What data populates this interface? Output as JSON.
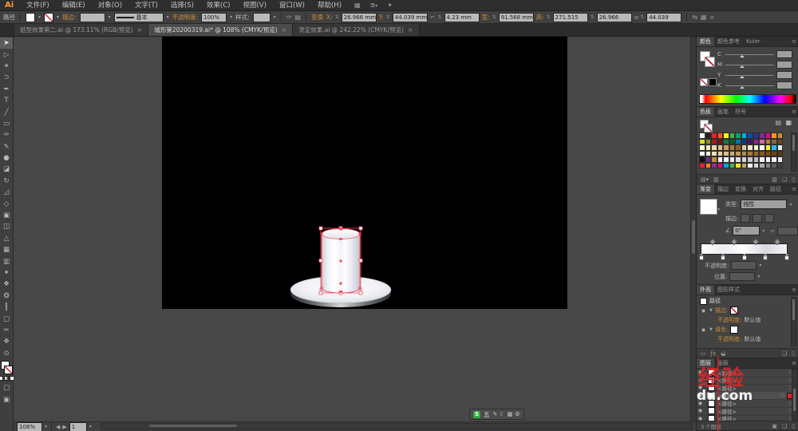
{
  "colors": {
    "accent_orange": "#c98a3c",
    "selection_red": "#f4485a",
    "artboard_bg": "#000000",
    "panel_bg": "#434343"
  },
  "menubar": {
    "logo": "Ai",
    "menus": [
      "文件(F)",
      "编辑(E)",
      "对象(O)",
      "文字(T)",
      "选择(S)",
      "效果(C)",
      "视图(V)",
      "窗口(W)",
      "帮助(H)"
    ]
  },
  "controlbar": {
    "selection_label": "路径",
    "stroke_label": "描边:",
    "profile_value": "基本",
    "opacity_label": "不透明度:",
    "opacity_value": "100%",
    "style_label": "样式:",
    "transform_label": "变换",
    "fields": [
      {
        "label": "X:",
        "value": "26.966 mm"
      },
      {
        "label": "Y:",
        "value": "44.039 mm"
      },
      {
        "label": "",
        "value": "4.23 mm"
      },
      {
        "label": "宽:",
        "value": "91.568 mm"
      },
      {
        "label": "高:",
        "value": "271.515"
      },
      {
        "label": "",
        "value": "26.966"
      },
      {
        "label": "",
        "value": "44.039"
      }
    ]
  },
  "tabbar": {
    "tabs": [
      {
        "title": "纸型效果第二.ai @ 173.11% (RGB/预览)",
        "active": false
      },
      {
        "title": "城形第20200319.ai* @ 108% (CMYK/预览)",
        "active": true
      },
      {
        "title": "烫定效果.ai @ 242.22% (CMYK/预览)",
        "active": false
      }
    ]
  },
  "toolbar": {
    "tools": [
      {
        "name": "selection-tool",
        "glyph": "➤",
        "active": true
      },
      {
        "name": "direct-selection-tool",
        "glyph": "▷",
        "active": false
      },
      {
        "name": "magic-wand-tool",
        "glyph": "✶",
        "active": false
      },
      {
        "name": "lasso-tool",
        "glyph": "⊃",
        "active": false
      },
      {
        "name": "pen-tool",
        "glyph": "✒",
        "active": false
      },
      {
        "name": "type-tool",
        "glyph": "T",
        "active": false
      },
      {
        "name": "line-segment-tool",
        "glyph": "╱",
        "active": false
      },
      {
        "name": "rectangle-tool",
        "glyph": "▭",
        "active": false
      },
      {
        "name": "paintbrush-tool",
        "glyph": "✑",
        "active": false
      },
      {
        "name": "pencil-tool",
        "glyph": "✎",
        "active": false
      },
      {
        "name": "blob-brush-tool",
        "glyph": "●",
        "active": false
      },
      {
        "name": "eraser-tool",
        "glyph": "◪",
        "active": false
      },
      {
        "name": "rotate-tool",
        "glyph": "↻",
        "active": false
      },
      {
        "name": "scale-tool",
        "glyph": "◿",
        "active": false
      },
      {
        "name": "width-tool",
        "glyph": "◇",
        "active": false
      },
      {
        "name": "free-transform-tool",
        "glyph": "▣",
        "active": false
      },
      {
        "name": "shape-builder-tool",
        "glyph": "◫",
        "active": false
      },
      {
        "name": "perspective-grid-tool",
        "glyph": "△",
        "active": false
      },
      {
        "name": "mesh-tool",
        "glyph": "▦",
        "active": false
      },
      {
        "name": "gradient-tool",
        "glyph": "▥",
        "active": false
      },
      {
        "name": "eyedropper-tool",
        "glyph": "✦",
        "active": false
      },
      {
        "name": "blend-tool",
        "glyph": "❖",
        "active": false
      },
      {
        "name": "symbol-sprayer-tool",
        "glyph": "❂",
        "active": false
      },
      {
        "name": "column-graph-tool",
        "glyph": "║",
        "active": false
      },
      {
        "name": "artboard-tool",
        "glyph": "▢",
        "active": false
      },
      {
        "name": "slice-tool",
        "glyph": "✂",
        "active": false
      },
      {
        "name": "hand-tool",
        "glyph": "✥",
        "active": false
      },
      {
        "name": "zoom-tool",
        "glyph": "⊙",
        "active": false
      }
    ]
  },
  "statusbar": {
    "zoom": "108%",
    "artboard": "1"
  },
  "ime": {
    "logo": "S",
    "mode": "五",
    "icons": [
      "✎",
      "☾",
      "▦",
      "⚙"
    ]
  },
  "color_panel": {
    "tabs": [
      "颜色",
      "颜色参考",
      "Kuler"
    ],
    "active_tab": 0,
    "channels": [
      "C",
      "M",
      "Y",
      "K"
    ]
  },
  "swatches_panel": {
    "tabs": [
      "色板",
      "画笔",
      "符号"
    ],
    "active_tab": 0,
    "grid": [
      [
        "#ffffff",
        "#221f1f",
        "#ea1c23",
        "#f15a24",
        "#fff21e",
        "#3db54a",
        "#00a560",
        "#00aeef",
        "#0c4da2",
        "#323094",
        "#7e2a8e",
        "#ec008c",
        "#f7941d",
        "#c58b2f"
      ],
      [
        "#d7de27",
        "#8c8c1c",
        "#a01e20",
        "#7a1010",
        "#0c8040",
        "#055f30",
        "#0076a8",
        "#0b3d74",
        "#46166b",
        "#93278f",
        "#d966a4",
        "#b0803f",
        "#8c6239",
        "#6e4a22"
      ],
      [
        "#fdf6d8",
        "#f7e8b8",
        "#ead9a8",
        "#d9bd85",
        "#c49a5e",
        "#a87a3a",
        "#8a5f26",
        "#d8cba4",
        "#efe6c4",
        "#f8f2dc",
        "#ffffff",
        "#f9ec31",
        "#2bb8ea",
        "#e6e7e8"
      ],
      [
        "#fcf8ea",
        "#f7efd4",
        "#efe2ba",
        "#e5d2a2",
        "#d9c08a",
        "#ccac72",
        "#bf9a5c",
        "#b28948",
        "#a57936",
        "#986a27",
        "#8a5c1b",
        "#7d4f12",
        "#6f430b",
        "#623806"
      ],
      [
        "#111111",
        "#6a2c86",
        "#bd8f33",
        "#ffffff",
        "#f4f4f4",
        "#e9e9e9",
        "#dedede",
        "#d3d3d3",
        "#c8c8c8",
        "#bdbdbd",
        "#ffffff",
        "#fafafa",
        "#f2f2f2",
        "#eaeaea"
      ],
      [
        "#e8212c",
        "#f58220",
        "#8b2f8f",
        "#e5087e",
        "#00a7e1",
        "#43b649",
        "#ffe81a",
        "#c7a06a",
        "#ffffff",
        "#d4d6d8",
        "#abadb0",
        "#838689",
        "#5b5e62",
        "#3f4245"
      ]
    ]
  },
  "gradient_panel": {
    "tabs": [
      "渐变",
      "描边",
      "变换",
      "对齐",
      "路径"
    ],
    "active_tab": 0,
    "type_label": "类型:",
    "type_value": "线性",
    "stroke_label": "描边:",
    "angle_value": "0°",
    "opacity_label": "不透明度:",
    "position_label": "位置:",
    "stops": [
      {
        "pos": 0,
        "color": "#ffffff"
      },
      {
        "pos": 25,
        "color": "#ececf1"
      },
      {
        "pos": 50,
        "color": "#ffffff"
      },
      {
        "pos": 75,
        "color": "#d8d8e0"
      },
      {
        "pos": 100,
        "color": "#f4f4f7"
      }
    ],
    "midpoints": [
      12.5,
      37.5,
      62.5,
      87.5
    ]
  },
  "appearance_panel": {
    "tabs": [
      "外观",
      "图形样式"
    ],
    "active_tab": 0,
    "object_label": "路径",
    "stroke_label": "描边:",
    "fill_label": "填色:",
    "opacity_label": "不透明度:",
    "opacity_value": "默认值"
  },
  "layers_panel": {
    "tabs": [
      "图层",
      "画板"
    ],
    "active_tab": 0,
    "rows": [
      {
        "name": "<路径>",
        "selected": false
      },
      {
        "name": "<路径>",
        "selected": false
      },
      {
        "name": "<路径>",
        "selected": false
      },
      {
        "name": "<路径>",
        "selected": true
      },
      {
        "name": "<路径>",
        "selected": false
      },
      {
        "name": "<路径>",
        "selected": false
      },
      {
        "name": "<路径>",
        "selected": false
      }
    ],
    "count_label": "3 个图层"
  },
  "watermark": {
    "line1": "经验",
    "line2": "du.com"
  }
}
